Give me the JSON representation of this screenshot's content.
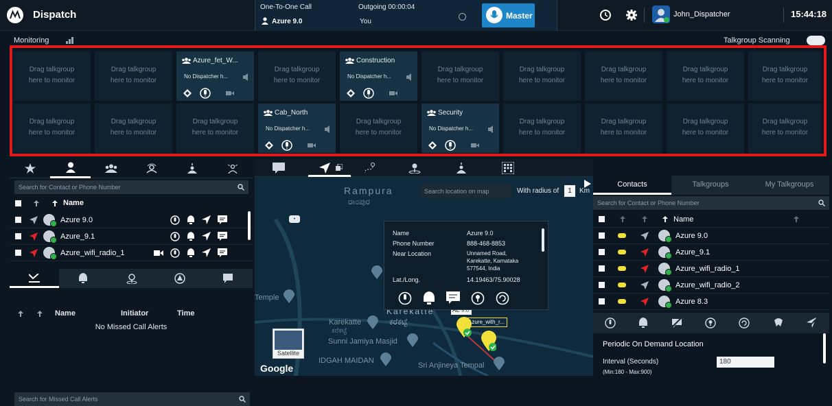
{
  "header": {
    "app_title": "Dispatch",
    "call_type": "One-To-One Call",
    "call_target": "Azure 9.0",
    "call_status": "Outgoing 00:00:04",
    "call_party": "You",
    "master_label": "Master",
    "user_name": "John_Dispatcher",
    "clock": "15:44:18"
  },
  "monitoring": {
    "title": "Monitoring",
    "scanning_label": "Talkgroup Scanning",
    "scanning_on": true
  },
  "tiles": {
    "empty_line1": "Drag talkgroup",
    "empty_line2": "here to monitor",
    "azure": {
      "name": "Azure_fet_W...",
      "status": "No Dispatcher h..."
    },
    "construction": {
      "name": "Construction",
      "status": "No Dispatcher h..."
    },
    "cab": {
      "name": "Cab_North",
      "status": "No Dispatcher h..."
    },
    "security": {
      "name": "Security",
      "status": "No Dispatcher h..."
    }
  },
  "contacts_left": {
    "search_placeholder": "Search for Contact or Phone Number",
    "name_header": "Name",
    "rows": [
      {
        "name": "Azure 9.0"
      },
      {
        "name": "Azure_9.1"
      },
      {
        "name": "Azure_wifi_radio_1"
      }
    ]
  },
  "alerts": {
    "search_placeholder": "Search for Missed Call Alerts",
    "col_name": "Name",
    "col_initiator": "Initiator",
    "col_time": "Time",
    "empty": "No Missed Call Alerts"
  },
  "map": {
    "search_placeholder": "Search location on map",
    "radius_label": "With radius of",
    "radius_value": "1",
    "radius_unit": "Km",
    "labels": {
      "rampura": "Rampura",
      "rampura_kn": "ರಾಂಪುರ",
      "karekatte": "Karekatte",
      "karekatte_kn": "ಕರೆಕಟ್ಟೆ",
      "karekatte_small": "Karekatte",
      "karekatte_small_kn": "ಕರೆಕಟ್ಟೆ",
      "temple": "Temple",
      "masjid": "Sunni Jamiya Masjid",
      "maidan": "IDGAH MAIDAN",
      "tempal": "Sri Anjineya Tempal",
      "satellite": "Satellite",
      "google": "Google",
      "marker_label": "Azure_with_r...",
      "ae_label": "AE",
      "ae_value": "9.0"
    },
    "popup": {
      "name_k": "Name",
      "name_v": "Azure 9.0",
      "phone_k": "Phone Number",
      "phone_v": "888-468-8853",
      "near_k": "Near Location",
      "near_v1": "Unnamed Road,",
      "near_v2": "Karekatte, Karnataka",
      "near_v3": "577544, India",
      "latlng_k": "Lat./Long.",
      "latlng_v": "14.19463/75.90028"
    }
  },
  "contacts_right": {
    "tab_contacts": "Contacts",
    "tab_talkgroups": "Talkgroups",
    "tab_my": "My Talkgroups",
    "search_placeholder": "Search for Contact or Phone Number",
    "name_header": "Name",
    "rows": [
      {
        "name": "Azure 9.0"
      },
      {
        "name": "Azure_9.1"
      },
      {
        "name": "Azure_wifi_radio_1"
      },
      {
        "name": "Azure_wifi_radio_2"
      },
      {
        "name": "Azure 8.3"
      }
    ],
    "pod_title": "Periodic On Demand Location",
    "interval_label": "Interval (Seconds)",
    "interval_range": "(Min:180 - Max:900)",
    "interval_value": "180"
  },
  "colors": {
    "accent": "#1f85c9",
    "alert_red": "#e01a1a",
    "status_green": "#2fb24a",
    "yellow": "#f2e03a"
  }
}
